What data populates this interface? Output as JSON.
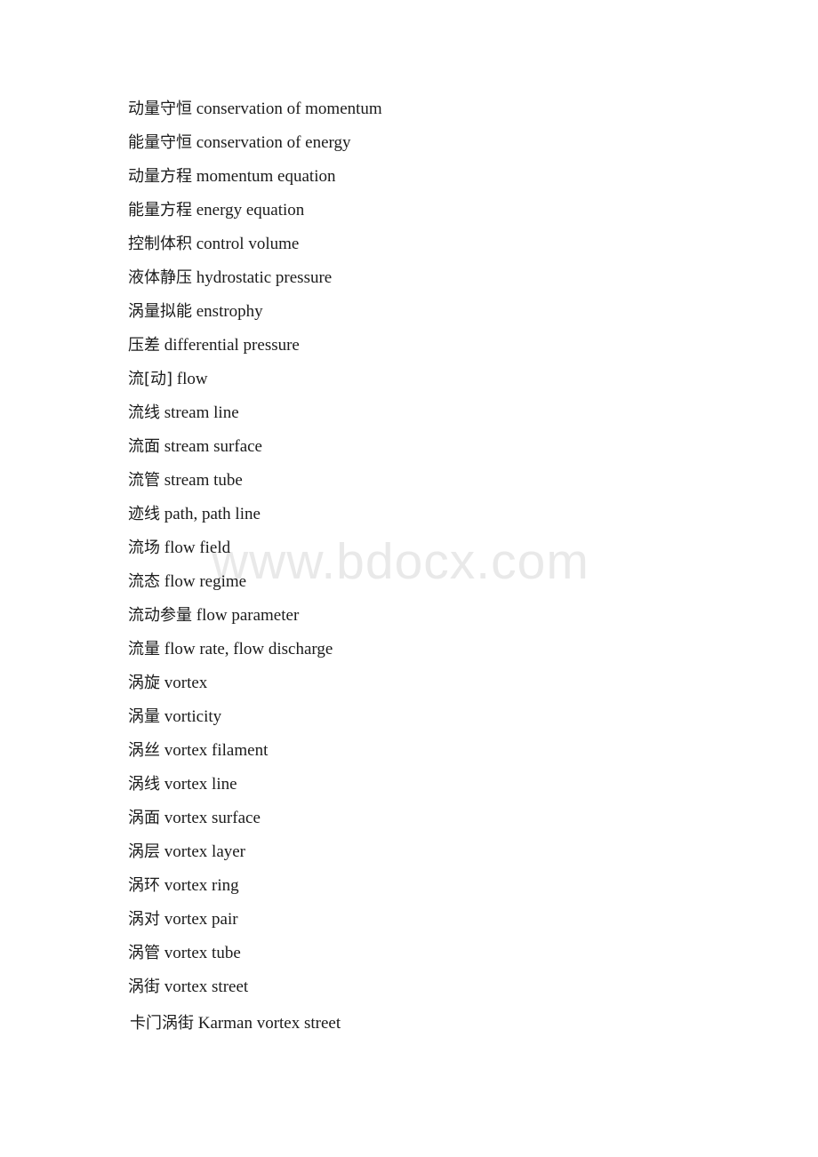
{
  "document": {
    "background_color": "#ffffff",
    "text_color": "#1b1b1b"
  },
  "watermark": {
    "text": "www.bdocx.com",
    "color": "#e9e9e9"
  },
  "glossary": {
    "entries": [
      {
        "zh": "动量守恒",
        "en": "conservation of momentum"
      },
      {
        "zh": "能量守恒",
        "en": "conservation of energy"
      },
      {
        "zh": "动量方程",
        "en": "momentum equation"
      },
      {
        "zh": "能量方程",
        "en": "energy equation"
      },
      {
        "zh": "控制体积",
        "en": "control volume"
      },
      {
        "zh": "液体静压",
        "en": "hydrostatic pressure"
      },
      {
        "zh": "涡量拟能",
        "en": "enstrophy"
      },
      {
        "zh": "压差",
        "en": "differential pressure"
      },
      {
        "zh": "流[动]",
        "en": "flow"
      },
      {
        "zh": "流线",
        "en": "stream line"
      },
      {
        "zh": "流面",
        "en": "stream surface"
      },
      {
        "zh": "流管",
        "en": "stream tube"
      },
      {
        "zh": "迹线",
        "en": "path, path line"
      },
      {
        "zh": "流场",
        "en": "flow field"
      },
      {
        "zh": "流态",
        "en": "flow regime"
      },
      {
        "zh": "流动参量",
        "en": "flow parameter"
      },
      {
        "zh": "流量",
        "en": "flow rate, flow discharge"
      },
      {
        "zh": "涡旋",
        "en": "vortex"
      },
      {
        "zh": "涡量",
        "en": "vorticity"
      },
      {
        "zh": "涡丝",
        "en": "vortex filament"
      },
      {
        "zh": "涡线",
        "en": "vortex line"
      },
      {
        "zh": "涡面",
        "en": "vortex surface"
      },
      {
        "zh": "涡层",
        "en": "vortex layer"
      },
      {
        "zh": "涡环",
        "en": "vortex ring"
      },
      {
        "zh": "涡对",
        "en": "vortex pair"
      },
      {
        "zh": "涡管",
        "en": "vortex tube"
      },
      {
        "zh": "涡街",
        "en": "vortex street"
      },
      {
        "zh": "卡门涡街",
        "en": "Karman vortex street"
      }
    ]
  }
}
